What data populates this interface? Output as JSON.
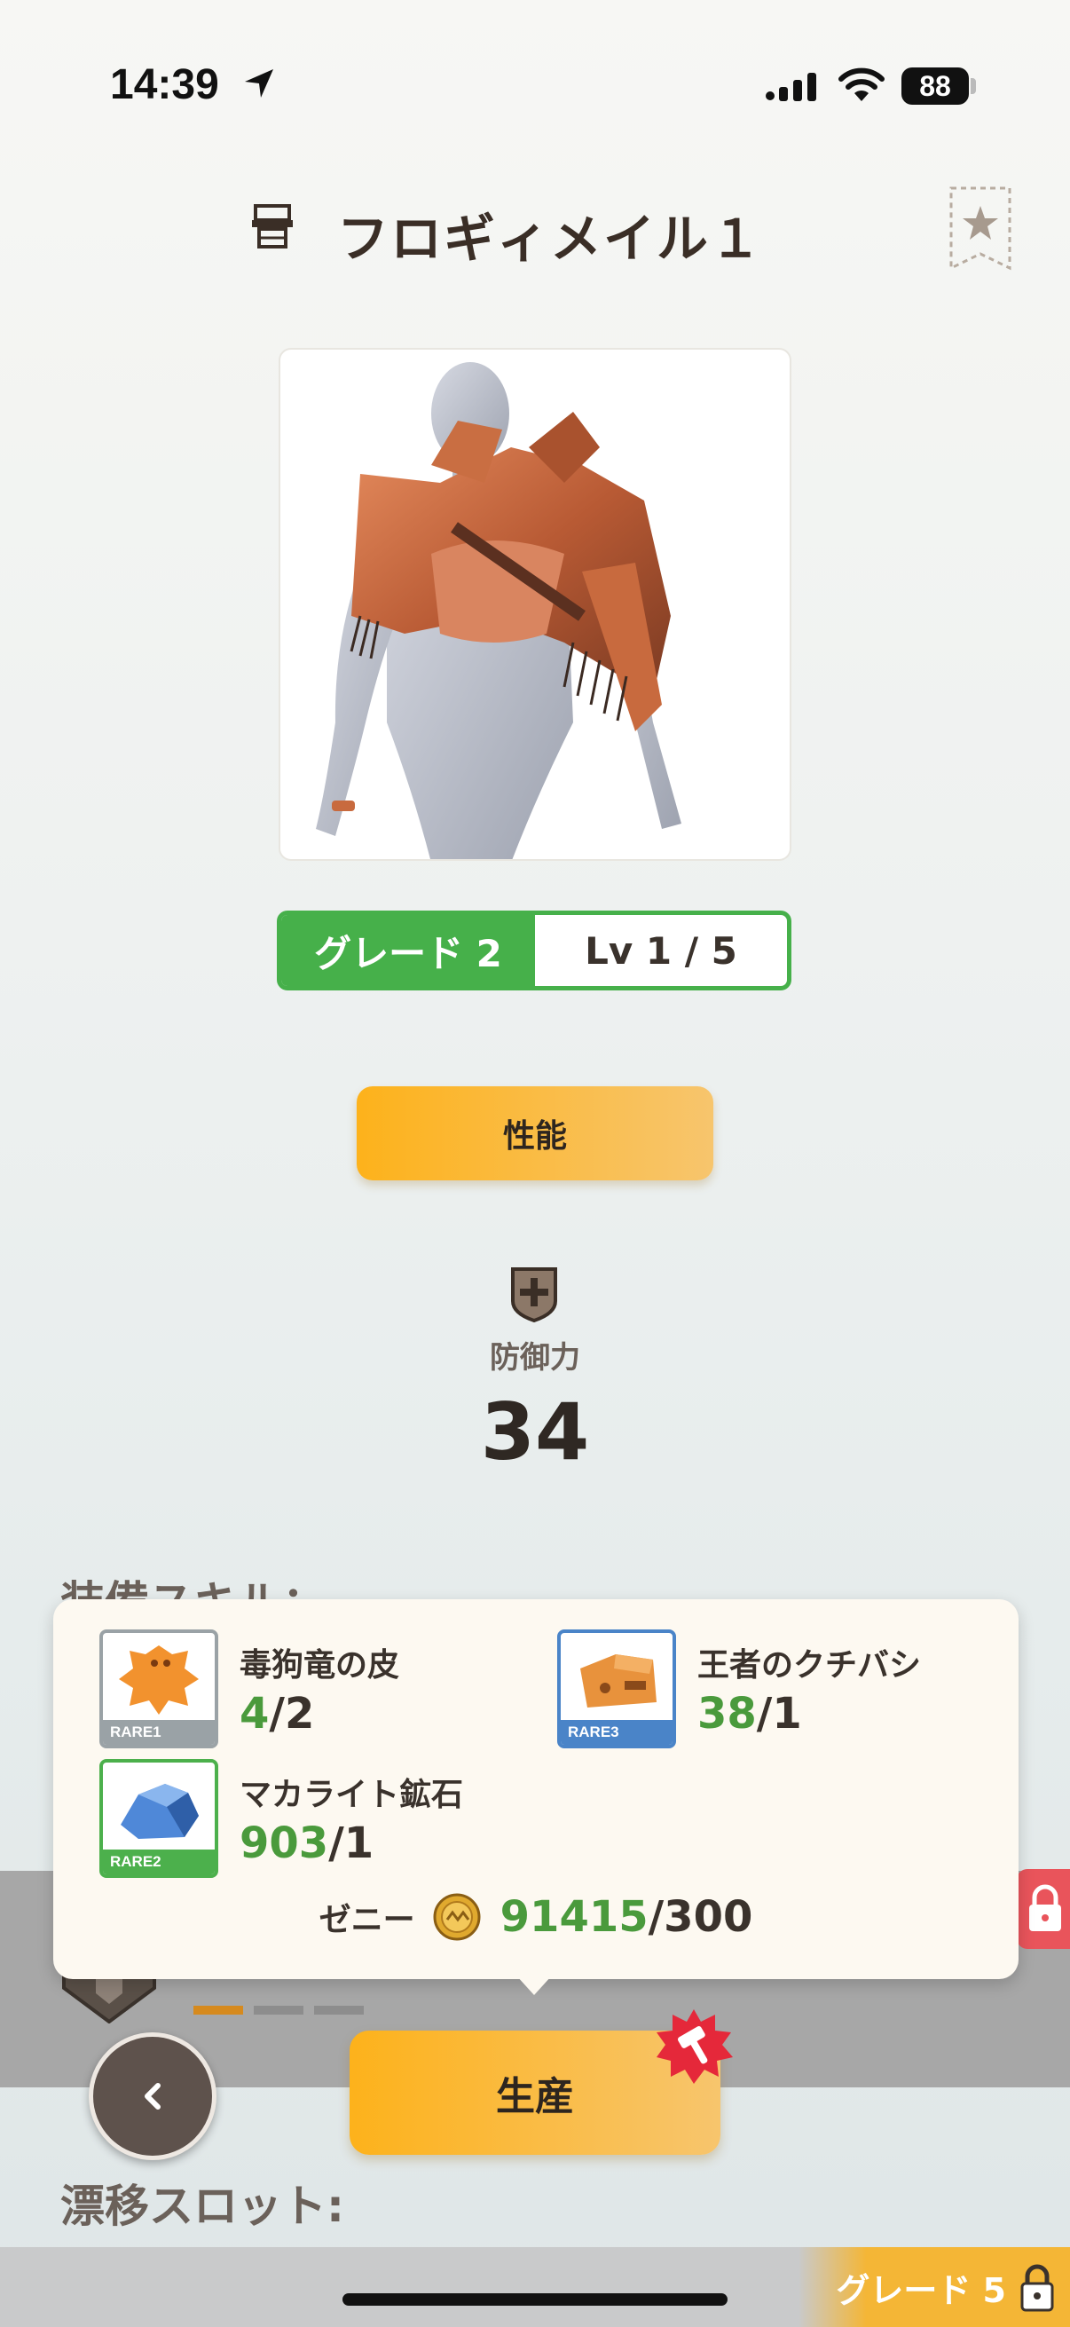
{
  "status_bar": {
    "time": "14:39",
    "battery": "88"
  },
  "header": {
    "title": "フロギィメイル１"
  },
  "grade": {
    "label": "グレード 2",
    "level": "Lv 1 / 5"
  },
  "tabs": {
    "performance": "性能"
  },
  "stats": {
    "defense_label": "防御力",
    "defense_value": "34"
  },
  "sections": {
    "skills": "装備スキル：",
    "drift_slots": "漂移スロット:"
  },
  "materials": [
    {
      "name": "毒狗竜の皮",
      "have": "4",
      "need": "/2",
      "rarity": "RARE1",
      "rarity_color": "#9aa2a6"
    },
    {
      "name": "王者のクチバシ",
      "have": "38",
      "need": "/1",
      "rarity": "RARE3",
      "rarity_color": "#4a84c8"
    },
    {
      "name": "マカライト鉱石",
      "have": "903",
      "need": "/1",
      "rarity": "RARE2",
      "rarity_color": "#4cb04c"
    }
  ],
  "zeny": {
    "label": "ゼニー",
    "have": "91415",
    "need": "/300"
  },
  "actions": {
    "produce": "生産",
    "grade5": "グレード 5"
  },
  "colors": {
    "accent_green": "#46b04a",
    "button_orange": "#fdb21b",
    "count_green": "#4a9a3c"
  }
}
